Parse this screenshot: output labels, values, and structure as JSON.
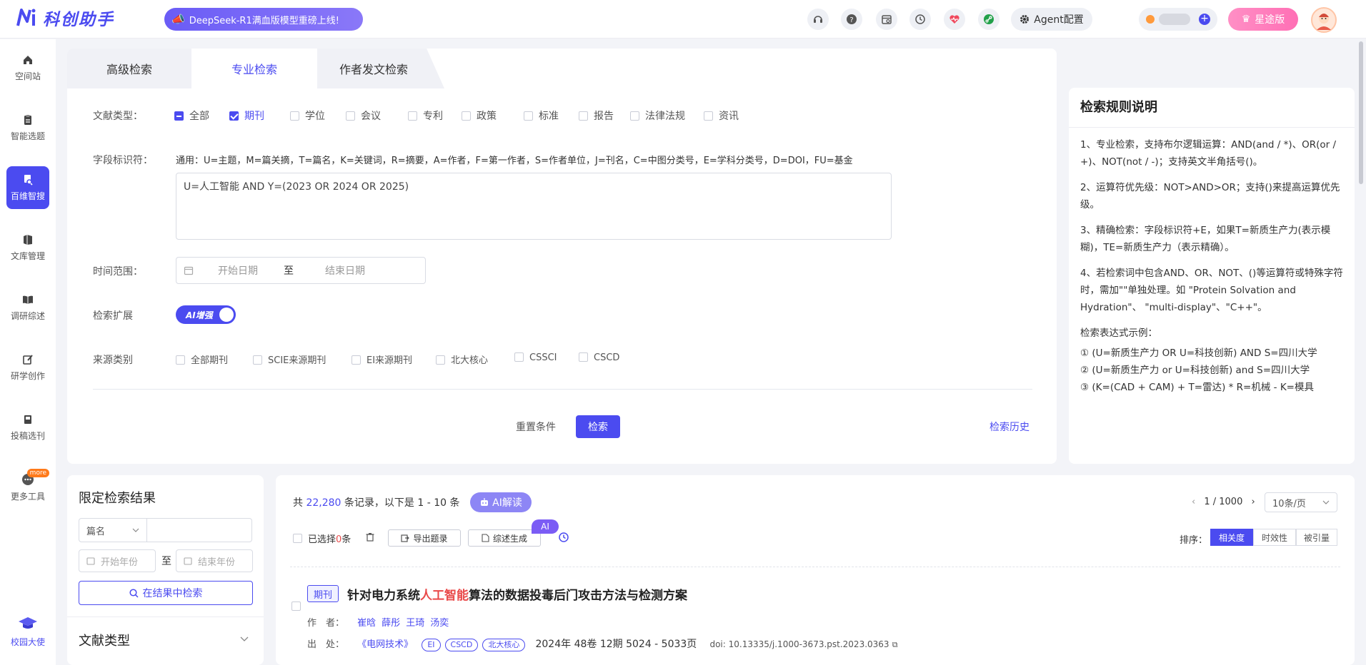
{
  "app": {
    "name": "科创助手",
    "promo": "DeepSeek-R1满血版模型重磅上线!",
    "agent_config": "Agent配置",
    "vip": "星途版",
    "icons": [
      "headset-icon",
      "help-icon",
      "calendar-icon",
      "history-icon",
      "heart-pulse-icon",
      "link-icon"
    ]
  },
  "sidebar": {
    "items": [
      {
        "label": "空间站",
        "icon": "home-icon"
      },
      {
        "label": "智能选题",
        "icon": "clipboard-icon"
      },
      {
        "label": "百维智搜",
        "icon": "search-doc-icon",
        "active": true
      },
      {
        "label": "文库管理",
        "icon": "library-icon"
      },
      {
        "label": "调研综述",
        "icon": "book-icon"
      },
      {
        "label": "研学创作",
        "icon": "edit-icon"
      },
      {
        "label": "投稿选刊",
        "icon": "submit-icon"
      },
      {
        "label": "更多工具",
        "icon": "more-icon",
        "badge": "more"
      }
    ],
    "ambassador": "校园大使"
  },
  "search": {
    "tabs": [
      "高级检索",
      "专业检索",
      "作者发文检索"
    ],
    "active_tab": 1,
    "doc_type_label": "文献类型：",
    "doc_types": [
      {
        "label": "全部",
        "state": "indeterminate"
      },
      {
        "label": "期刊",
        "state": "checked"
      },
      {
        "label": "学位",
        "state": "unchecked"
      },
      {
        "label": "会议",
        "state": "unchecked"
      },
      {
        "label": "专利",
        "state": "unchecked"
      },
      {
        "label": "政策",
        "state": "unchecked"
      },
      {
        "label": "标准",
        "state": "unchecked"
      },
      {
        "label": "报告",
        "state": "unchecked"
      },
      {
        "label": "法律法规",
        "state": "unchecked"
      },
      {
        "label": "资讯",
        "state": "unchecked"
      }
    ],
    "field_label": "字段标识符：",
    "field_desc": "通用：U=主题，M=篇关摘，T=篇名，K=关键词，R=摘要，A=作者，F=第一作者，S=作者单位，J=刊名，C=中图分类号，E=学科分类号，D=DOI，FU=基金",
    "query": "U=人工智能 AND Y=(2023 OR 2024 OR 2025)",
    "time_label": "时间范围：",
    "start_date": "开始日期",
    "to": "至",
    "end_date": "结束日期",
    "expand_label": "检索扩展",
    "ai_toggle": "AI增强",
    "source_label": "来源类别",
    "sources": [
      "全部期刊",
      "SCIE来源期刊",
      "EI来源期刊",
      "北大核心",
      "CSSCI",
      "CSCD"
    ],
    "reset": "重置条件",
    "search": "检索",
    "history": "检索历史"
  },
  "rules": {
    "title": "检索规则说明",
    "items": [
      "1、专业检索，支持布尔逻辑运算：AND(and / *)、OR(or / +)、NOT(not / -)；支持英文半角括号()。",
      "2、运算符优先级：NOT>AND>OR；支持()来提高运算优先级。",
      "3、精确检索：字段标识符+E，如果T=新质生产力(表示模糊)，TE=新质生产力（表示精确）。",
      "4、若检索词中包含AND、OR、NOT、()等运算符或特殊字符时，需加\"\"单独处理。如 \"Protein Solvation and Hydration\"、 \"multi-display\"、\"C++\"。"
    ],
    "example_title": "检索表达式示例：",
    "examples": [
      "① (U=新质生产力 OR U=科技创新) AND S=四川大学",
      "② (U=新质生产力 or U=科技创新) and S=四川大学",
      "③ (K=(CAD + CAM) + T=雷达) * R=机械 - K=模具"
    ]
  },
  "filter": {
    "title": "限定检索结果",
    "field_select": "篇名",
    "start_year": "开始年份",
    "to": "至",
    "end_year": "结束年份",
    "search_in_results": "在结果中检索",
    "doc_type": "文献类型"
  },
  "results": {
    "count_prefix": "共",
    "total": "22,280",
    "count_suffix": "条记录，以下是 1 - 10 条",
    "ai_read": "AI解读",
    "page": "1 / 1000",
    "per_page": "10条/页",
    "selected_prefix": "已选择",
    "selected_count": "0",
    "selected_suffix": "条",
    "export": "导出题录",
    "summary": "综述生成",
    "ai_tag": "AI",
    "sort_label": "排序：",
    "sort_options": [
      "相关度",
      "时效性",
      "被引量"
    ],
    "sort_active": 0,
    "article": {
      "tag": "期刊",
      "title_pre": "针对电力系统",
      "title_hl": "人工智能",
      "title_post": "算法的数据投毒后门攻击方法与检测方案",
      "author_label": "作　者：",
      "authors": [
        "崔晗",
        "薛彤",
        "王琦",
        "汤奕"
      ],
      "source_label": "出　处：",
      "journal": "《电网技术》",
      "badges": [
        "EI",
        "CSCD",
        "北大核心"
      ],
      "issue": "2024年 48卷 12期 5024 - 5033页",
      "doi": "doi: 10.13335/j.1000-3673.pst.2023.0363"
    }
  }
}
